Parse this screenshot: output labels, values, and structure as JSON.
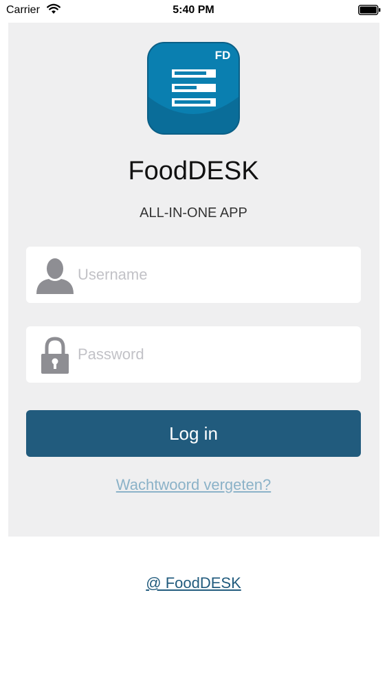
{
  "status_bar": {
    "carrier": "Carrier",
    "time": "5:40 PM"
  },
  "app": {
    "icon_badge": "FD",
    "title": "FoodDESK",
    "subtitle": "ALL-IN-ONE APP"
  },
  "login_form": {
    "username": {
      "value": "",
      "placeholder": "Username"
    },
    "password": {
      "value": "",
      "placeholder": "Password"
    },
    "login_label": "Log in",
    "forgot_password_label": "Wachtwoord vergeten?"
  },
  "footer": {
    "link_label": "@ FoodDESK"
  },
  "colors": {
    "brand_blue": "#215b7d",
    "icon_blue": "#0a7fb0",
    "panel_background": "#efeff0",
    "link_light": "#8bb2c8"
  }
}
